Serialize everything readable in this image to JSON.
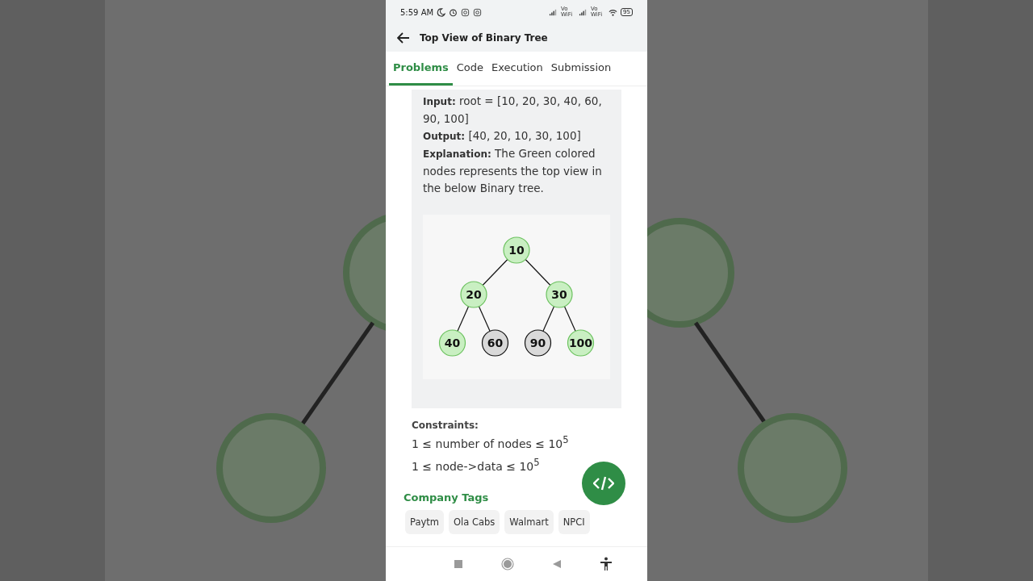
{
  "status_bar": {
    "time": "5:59 AM",
    "network_labels": [
      "Vo WiFi",
      "Vo WiFi"
    ],
    "battery": "95"
  },
  "header": {
    "title": "Top View of Binary Tree"
  },
  "tabs": [
    {
      "label": "Problems",
      "selected": true
    },
    {
      "label": "Code",
      "selected": false
    },
    {
      "label": "Execution",
      "selected": false
    },
    {
      "label": "Submission",
      "selected": false
    }
  ],
  "example": {
    "lines": [
      "**Input:** root = [10, 20, 30, 40, 60, 90, 100]",
      "**Output:** [40, 20, 10, 30, 100]",
      "**Explanation:** The Green colored nodes represents the top view in the below Binary tree."
    ],
    "tree": {
      "value": "10",
      "highlighted": true,
      "children": [
        {
          "value": "20",
          "highlighted": true,
          "children": [
            {
              "value": "40",
              "highlighted": true
            },
            {
              "value": "60",
              "highlighted": false
            }
          ]
        },
        {
          "value": "30",
          "highlighted": true,
          "children": [
            {
              "value": "90",
              "highlighted": false
            },
            {
              "value": "100",
              "highlighted": true
            }
          ]
        }
      ]
    }
  },
  "constraints": {
    "heading": "Constraints:",
    "lines": [
      "1 ≤ number of nodes ≤ 10$^{5}$",
      "1 ≤ node->data ≤ 10$^{5}$"
    ]
  },
  "company_tags": {
    "heading": "Company Tags",
    "tags": [
      "Paytm",
      "Ola Cabs",
      "Walmart",
      "NPCI"
    ]
  }
}
